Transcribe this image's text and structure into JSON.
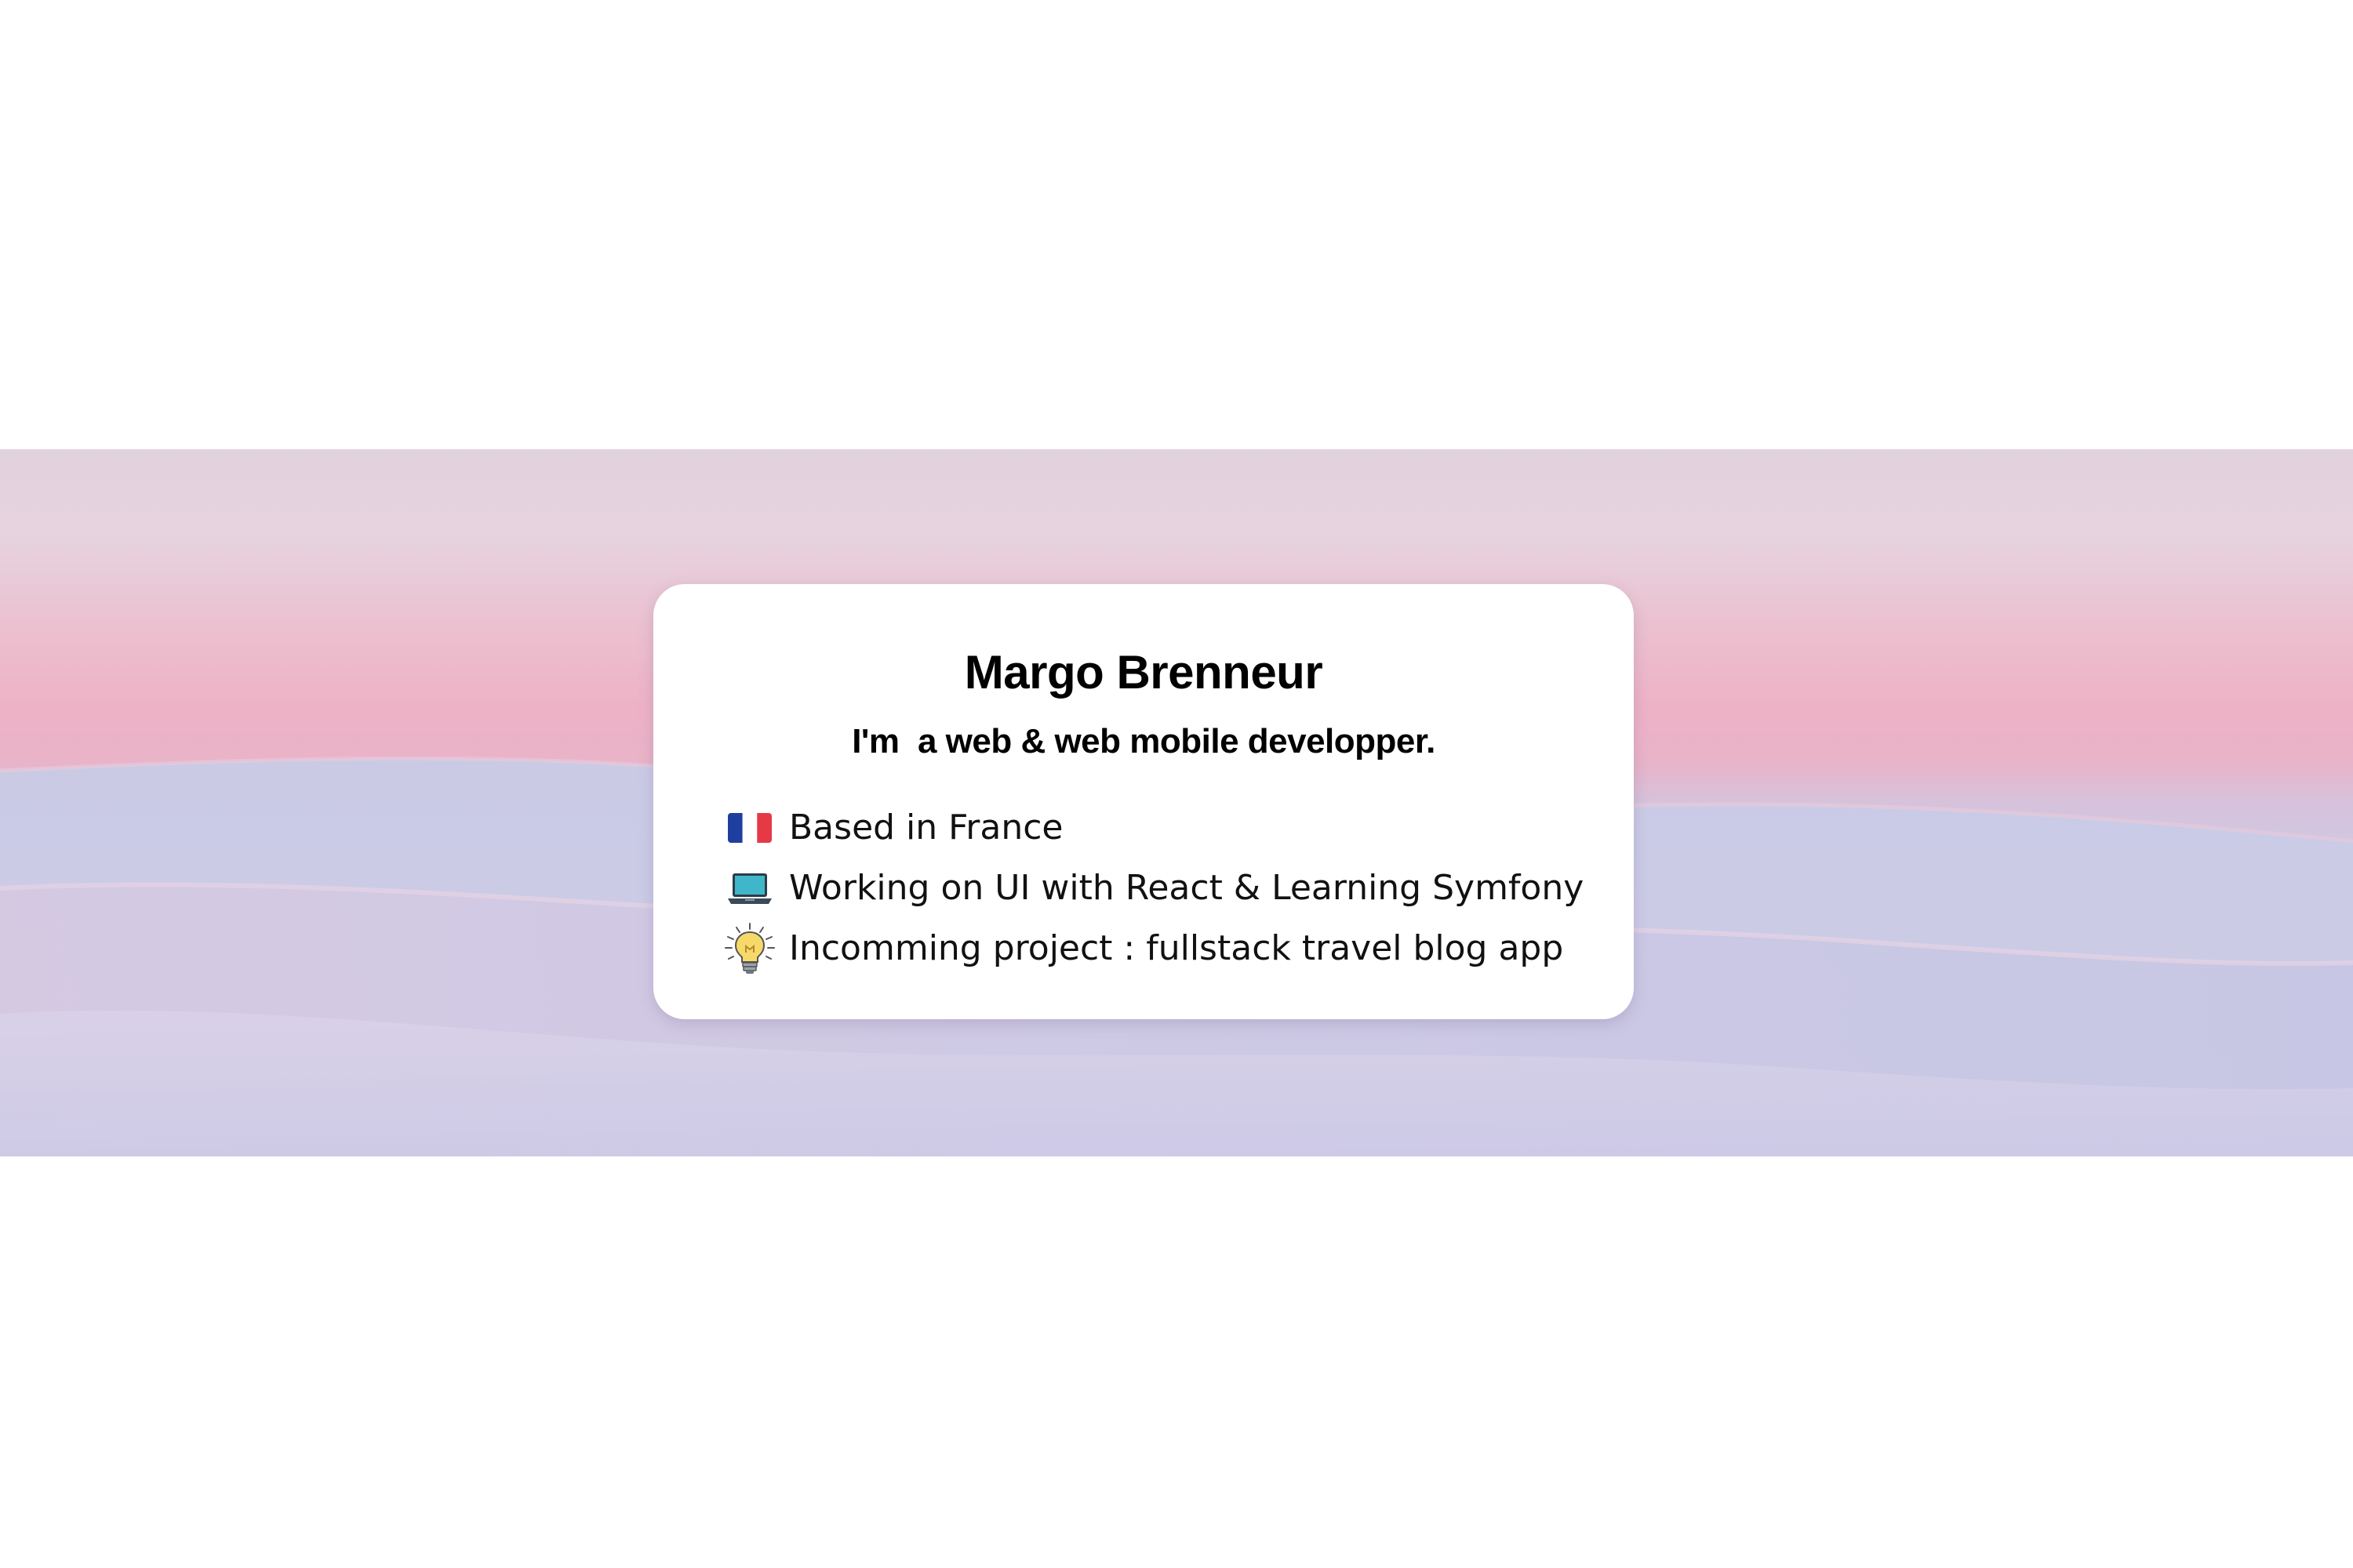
{
  "profile": {
    "name": "Margo Brenneur",
    "tagline": "I'm  a web & web mobile developper."
  },
  "facts": [
    {
      "icon": "france-flag-icon",
      "text": "Based in France"
    },
    {
      "icon": "laptop-icon",
      "text": "Working on UI with React & Learning Symfony"
    },
    {
      "icon": "lightbulb-icon",
      "text": "Incomming project : fullstack travel blog app"
    }
  ],
  "colors": {
    "flag_blue": "#1f3fa0",
    "flag_white": "#ffffff",
    "flag_red": "#e63946",
    "bulb_yellow": "#f7d96a"
  }
}
